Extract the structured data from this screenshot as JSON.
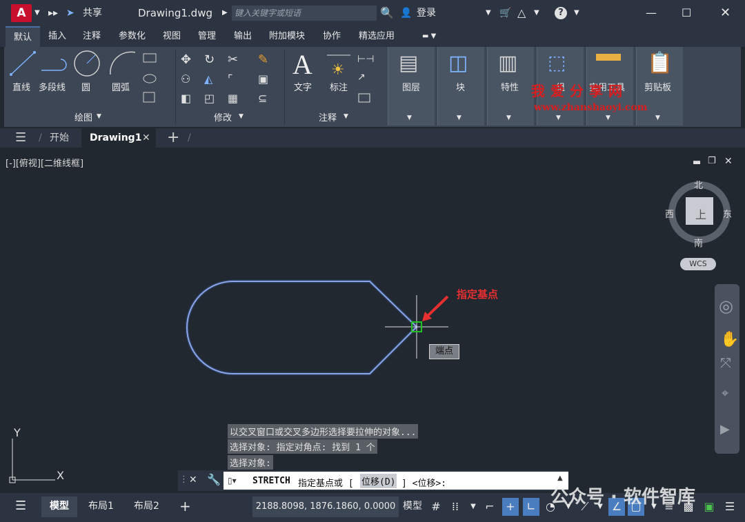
{
  "title": {
    "share": "共享",
    "filename": "Drawing1.dwg",
    "search_placeholder": "键入关键字或短语",
    "login": "登录"
  },
  "menus": [
    "默认",
    "插入",
    "注释",
    "参数化",
    "视图",
    "管理",
    "输出",
    "附加模块",
    "协作",
    "精选应用"
  ],
  "ribbon": {
    "draw_tools": [
      "直线",
      "多段线",
      "圆",
      "圆弧"
    ],
    "draw_panel": "绘图",
    "modify_panel": "修改",
    "annotate_tools": [
      "文字",
      "标注"
    ],
    "annotate_panel": "注释",
    "big_panels": [
      "图层",
      "块",
      "特性",
      "组",
      "实用工具",
      "剪贴板"
    ]
  },
  "tabs": {
    "start": "开始",
    "drawing": "Drawing1"
  },
  "viewport": {
    "label": "[-][俯视][二维线框]",
    "compass": {
      "north": "北",
      "south": "南",
      "east": "东",
      "west": "西",
      "top": "上"
    },
    "wcs": "WCS",
    "tooltip": "端点",
    "annotation": "指定基点",
    "ucs_y": "Y",
    "ucs_x": "X"
  },
  "command_history": [
    "以交叉窗口或交叉多边形选择要拉伸的对象...",
    "选择对象: 指定对角点: 找到 1 个",
    "选择对象:"
  ],
  "command_input": {
    "command": "STRETCH",
    "prompt": "指定基点或 [",
    "option": "位移(D)",
    "suffix": "] <位移>:"
  },
  "status": {
    "model_tab": "模型",
    "layout1": "布局1",
    "layout2": "布局2",
    "coords": "2188.8098, 1876.1860, 0.0000",
    "space": "模型"
  },
  "watermark": {
    "line1": "我爱分享网",
    "line2": "www.zhanshaoyi.com",
    "gzh": "公众号 · 软件智库"
  },
  "colors": {
    "accent": "#4a7dc0",
    "brand": "#c8102e",
    "shape": "#9db8f0",
    "annot": "#e83030"
  }
}
